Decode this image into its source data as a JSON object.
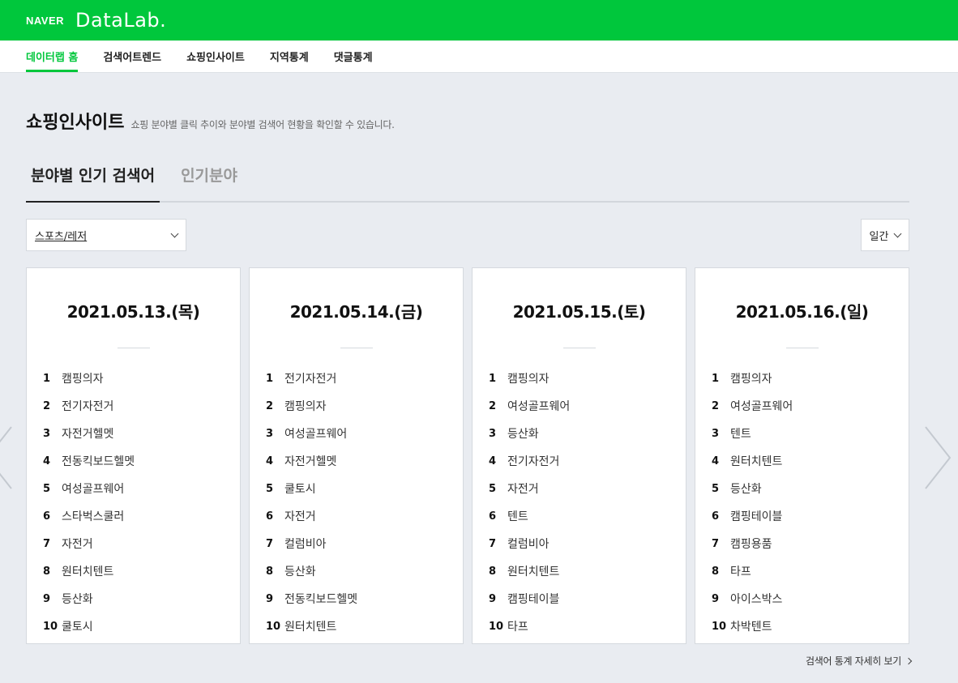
{
  "header": {
    "brand": "NAVER",
    "product": "DataLab."
  },
  "nav": [
    {
      "label": "데이터랩 홈",
      "active": true
    },
    {
      "label": "검색어트렌드",
      "active": false
    },
    {
      "label": "쇼핑인사이트",
      "active": false
    },
    {
      "label": "지역통계",
      "active": false
    },
    {
      "label": "댓글통계",
      "active": false
    }
  ],
  "page": {
    "title": "쇼핑인사이트",
    "description": "쇼핑 분야별 클릭 추이와 분야별 검색어 현황을 확인할 수 있습니다."
  },
  "tabs": [
    {
      "label": "분야별 인기 검색어",
      "active": true
    },
    {
      "label": "인기분야",
      "active": false
    }
  ],
  "filters": {
    "category": "스포츠/레저",
    "period": "일간"
  },
  "cards": [
    {
      "date": "2021.05.13.(목)",
      "items": [
        "캠핑의자",
        "전기자전거",
        "자전거헬멧",
        "전동킥보드헬멧",
        "여성골프웨어",
        "스타벅스쿨러",
        "자전거",
        "원터치텐트",
        "등산화",
        "쿨토시"
      ]
    },
    {
      "date": "2021.05.14.(금)",
      "items": [
        "전기자전거",
        "캠핑의자",
        "여성골프웨어",
        "자전거헬멧",
        "쿨토시",
        "자전거",
        "컬럼비아",
        "등산화",
        "전동킥보드헬멧",
        "원터치텐트"
      ]
    },
    {
      "date": "2021.05.15.(토)",
      "items": [
        "캠핑의자",
        "여성골프웨어",
        "등산화",
        "전기자전거",
        "자전거",
        "텐트",
        "컬럼비아",
        "원터치텐트",
        "캠핑테이블",
        "타프"
      ]
    },
    {
      "date": "2021.05.16.(일)",
      "items": [
        "캠핑의자",
        "여성골프웨어",
        "텐트",
        "원터치텐트",
        "등산화",
        "캠핑테이블",
        "캠핑용품",
        "타프",
        "아이스박스",
        "차박텐트"
      ]
    }
  ],
  "more_link": "검색어 통계 자세히 보기",
  "icons": {
    "prev": "chevron-left-icon",
    "next": "chevron-right-icon",
    "dropdown": "chevron-down-icon"
  },
  "colors": {
    "brand": "#00c73c",
    "background": "#e9ecf1"
  }
}
